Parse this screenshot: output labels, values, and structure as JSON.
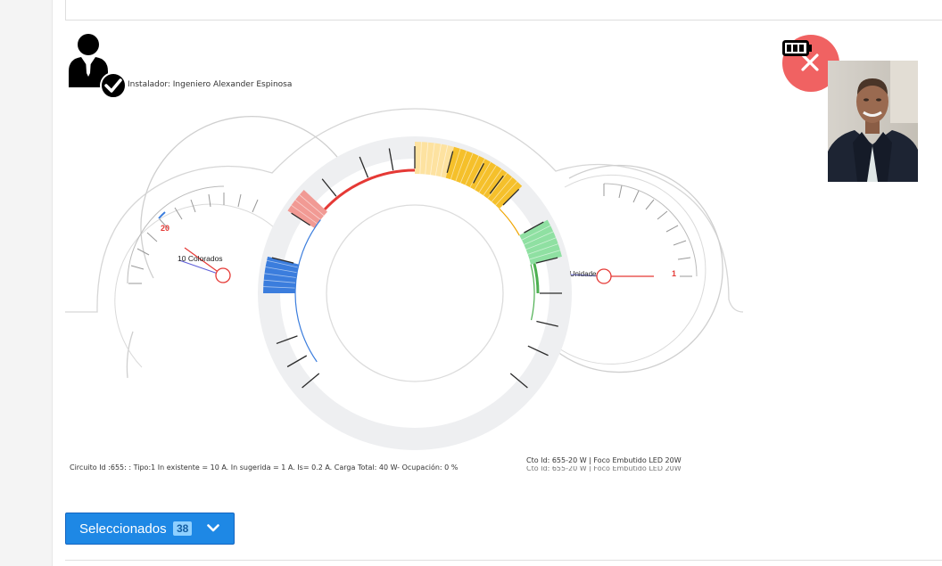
{
  "installer": {
    "label": "Instalador: Ingeniero Alexander Espinosa"
  },
  "gauges": {
    "left": {
      "max_label": "20",
      "needle_label": "10 Colorados"
    },
    "right": {
      "max_label": "1",
      "needle_label": "0 Unidades"
    }
  },
  "footer": {
    "circuit_info": "Circuito Id :655: : Tipo:1 In existente = 10 A. In sugerida = 1 A. Is= 0.2 A. Carga Total: 40 W- Ocupación: 0 %",
    "cto_info": "Cto Id: 655-20 W | Foco Embutido LED 20W",
    "cto_info_2": "Cto Id: 655-20 W | Foco Embutido LED 20W"
  },
  "selector": {
    "label": "Seleccionados",
    "count": "38"
  },
  "colors": {
    "accent": "#1e88e5",
    "close": "#f06262",
    "red": "#e53935",
    "yellow": "#f5c02b",
    "green": "#4caf50",
    "blue": "#3b7ddd"
  },
  "icons": [
    "user-check-icon",
    "battery-icon",
    "close-icon",
    "chevron-down-icon"
  ]
}
